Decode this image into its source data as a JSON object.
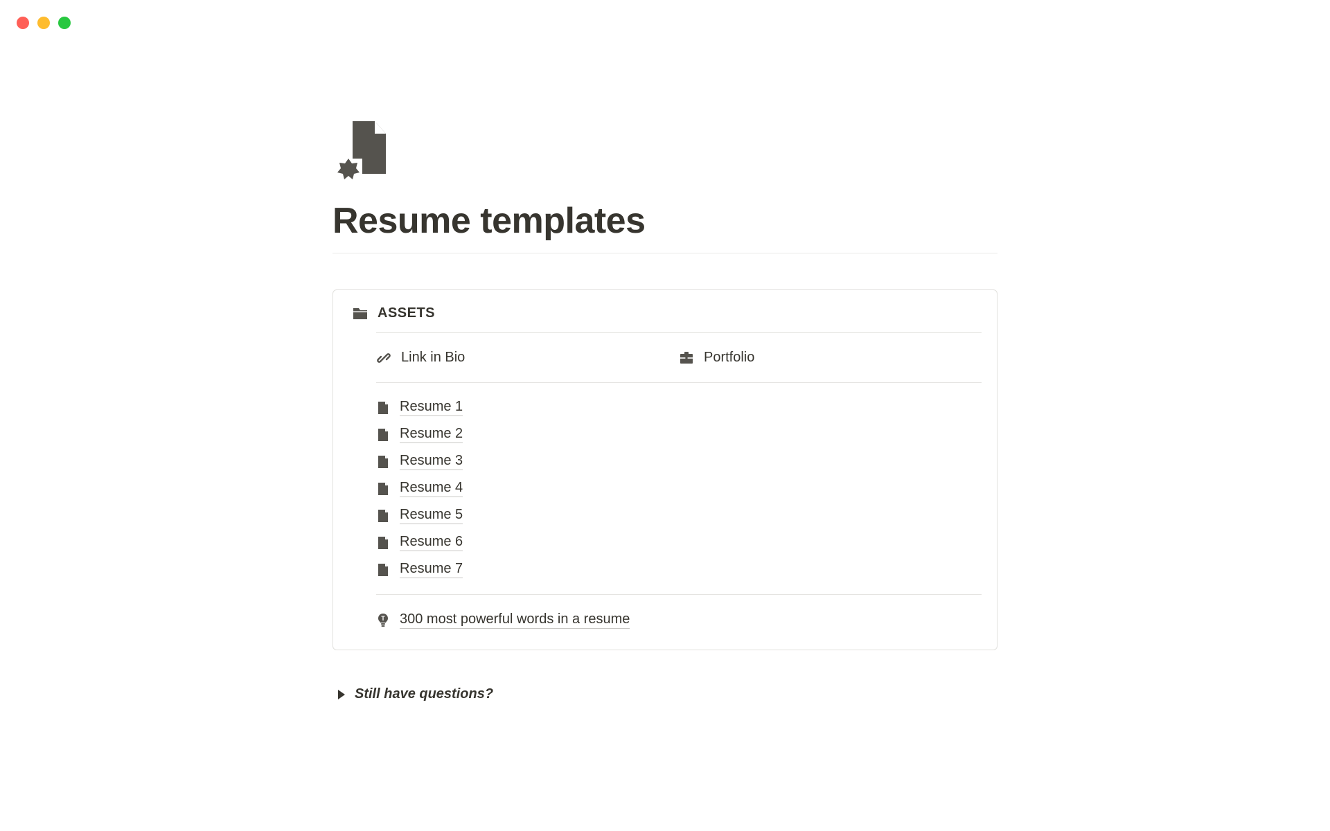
{
  "window": {
    "controls": [
      "close",
      "minimize",
      "zoom"
    ]
  },
  "page": {
    "icon": "file-badge-icon",
    "title": "Resume templates"
  },
  "assets": {
    "header_label": "ASSETS",
    "top_links": [
      {
        "icon": "link-icon",
        "label": "Link in Bio"
      },
      {
        "icon": "briefcase-icon",
        "label": "Portfolio"
      }
    ],
    "resumes": [
      {
        "icon": "page-icon",
        "label": "Resume 1"
      },
      {
        "icon": "page-icon",
        "label": "Resume 2"
      },
      {
        "icon": "page-icon",
        "label": "Resume 3"
      },
      {
        "icon": "page-icon",
        "label": "Resume 4"
      },
      {
        "icon": "page-icon",
        "label": "Resume 5"
      },
      {
        "icon": "page-icon",
        "label": "Resume 6"
      },
      {
        "icon": "page-icon",
        "label": "Resume 7"
      }
    ],
    "tip": {
      "icon": "lightbulb-icon",
      "label": "300 most powerful words in a resume"
    }
  },
  "toggle": {
    "label": "Still have questions?"
  }
}
